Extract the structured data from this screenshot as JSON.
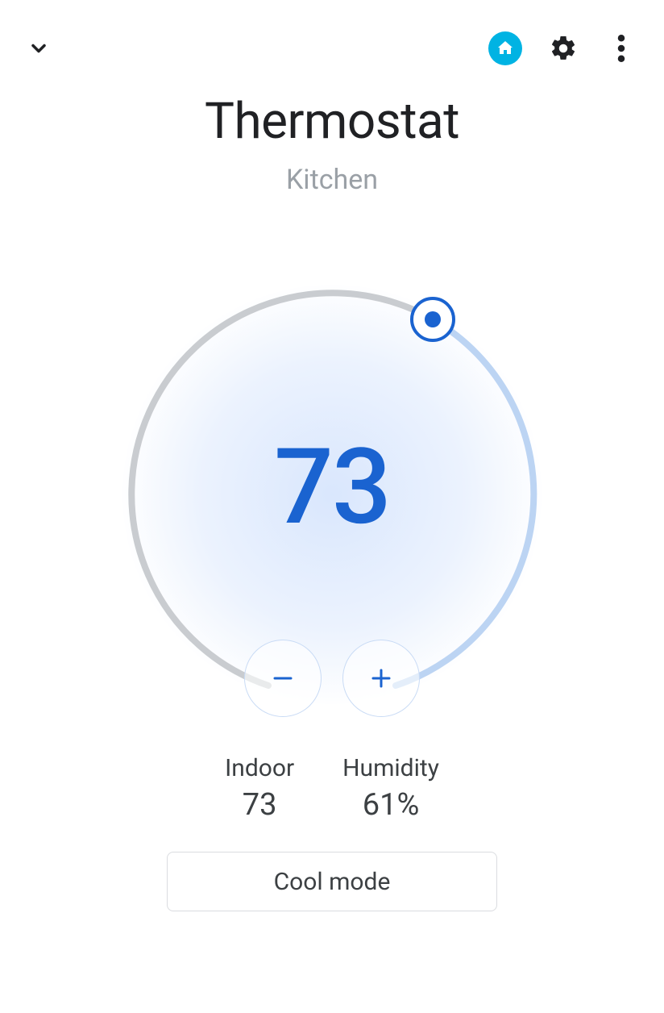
{
  "header": {
    "title": "Thermostat",
    "subtitle": "Kitchen"
  },
  "dial": {
    "target_temp": "73",
    "handle_angle_deg": 30
  },
  "controls": {
    "decrease_symbol": "−",
    "increase_symbol": "+"
  },
  "stats": {
    "indoor_label": "Indoor",
    "indoor_value": "73",
    "humidity_label": "Humidity",
    "humidity_value": "61%"
  },
  "mode": {
    "label": "Cool mode"
  },
  "colors": {
    "accent_blue": "#1a63d0",
    "home_badge": "#00b3e3",
    "arc_grey": "#c9ccd0",
    "arc_blue": "#bcd4f3"
  }
}
